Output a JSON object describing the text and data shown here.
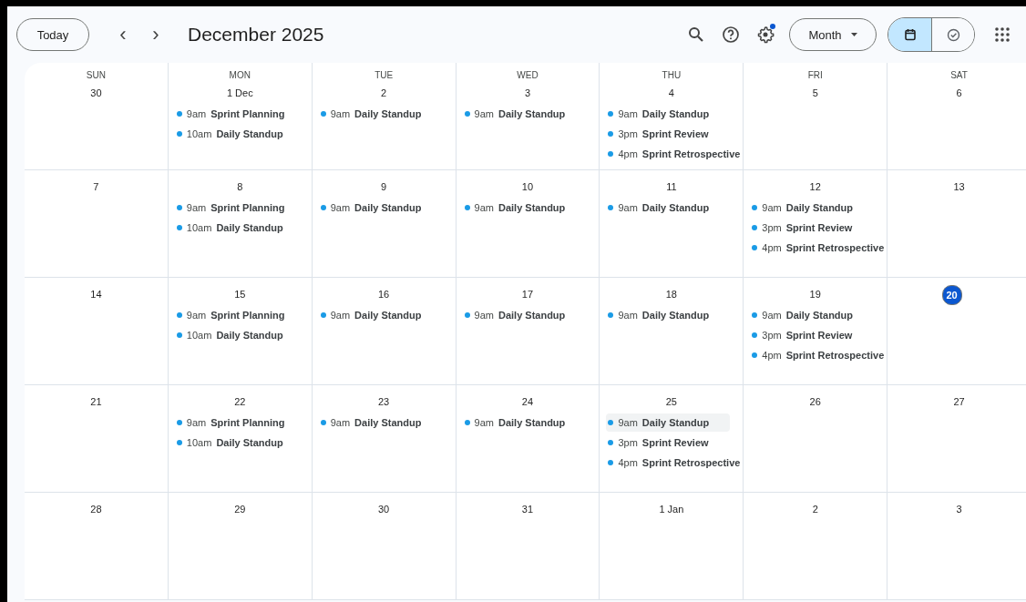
{
  "toolbar": {
    "today_button": "Today",
    "prev": "‹",
    "next": "›",
    "title": "December 2025",
    "view_dropdown": "Month",
    "notification_dot": true,
    "view_toggle": [
      {
        "kind": "calendar",
        "selected": true
      },
      {
        "kind": "tasks",
        "selected": false
      }
    ]
  },
  "weeks": [
    {
      "days": [
        {
          "weekday": "SUN",
          "date": "30",
          "today": false
        },
        {
          "weekday": "MON",
          "date": "1 Dec",
          "today": false,
          "events": [
            {
              "time": "9am",
              "title": "Sprint Planning",
              "color": "#1a9be6",
              "highlighted": false
            },
            {
              "time": "10am",
              "title": "Daily Standup",
              "color": "#1a9be6",
              "highlighted": false
            }
          ]
        },
        {
          "weekday": "TUE",
          "date": "2",
          "today": false,
          "events": [
            {
              "time": "9am",
              "title": "Daily Standup",
              "color": "#1a9be6",
              "highlighted": false
            }
          ]
        },
        {
          "weekday": "WED",
          "date": "3",
          "today": false,
          "events": [
            {
              "time": "9am",
              "title": "Daily Standup",
              "color": "#1a9be6",
              "highlighted": false
            }
          ]
        },
        {
          "weekday": "THU",
          "date": "4",
          "today": false,
          "events": [
            {
              "time": "9am",
              "title": "Daily Standup",
              "color": "#1a9be6",
              "highlighted": false
            },
            {
              "time": "3pm",
              "title": "Sprint Review",
              "color": "#1a9be6",
              "highlighted": false
            },
            {
              "time": "4pm",
              "title": "Sprint Retrospective",
              "color": "#1a9be6",
              "highlighted": false
            }
          ]
        },
        {
          "weekday": "FRI",
          "date": "5",
          "today": false
        },
        {
          "weekday": "SAT",
          "date": "6",
          "today": false
        }
      ]
    },
    {
      "days": [
        {
          "date": "7",
          "today": false
        },
        {
          "date": "8",
          "today": false,
          "events": [
            {
              "time": "9am",
              "title": "Sprint Planning",
              "color": "#1a9be6",
              "highlighted": false
            },
            {
              "time": "10am",
              "title": "Daily Standup",
              "color": "#1a9be6",
              "highlighted": false
            }
          ]
        },
        {
          "date": "9",
          "today": false,
          "events": [
            {
              "time": "9am",
              "title": "Daily Standup",
              "color": "#1a9be6",
              "highlighted": false
            }
          ]
        },
        {
          "date": "10",
          "today": false,
          "events": [
            {
              "time": "9am",
              "title": "Daily Standup",
              "color": "#1a9be6",
              "highlighted": false
            }
          ]
        },
        {
          "date": "11",
          "today": false,
          "events": [
            {
              "time": "9am",
              "title": "Daily Standup",
              "color": "#1a9be6",
              "highlighted": false
            }
          ]
        },
        {
          "date": "12",
          "today": false,
          "events": [
            {
              "time": "9am",
              "title": "Daily Standup",
              "color": "#1a9be6",
              "highlighted": false
            },
            {
              "time": "3pm",
              "title": "Sprint Review",
              "color": "#1a9be6",
              "highlighted": false
            },
            {
              "time": "4pm",
              "title": "Sprint Retrospective",
              "color": "#1a9be6",
              "highlighted": false
            }
          ]
        },
        {
          "date": "13",
          "today": false
        }
      ]
    },
    {
      "days": [
        {
          "date": "14",
          "today": false
        },
        {
          "date": "15",
          "today": false,
          "events": [
            {
              "time": "9am",
              "title": "Sprint Planning",
              "color": "#1a9be6",
              "highlighted": false
            },
            {
              "time": "10am",
              "title": "Daily Standup",
              "color": "#1a9be6",
              "highlighted": false
            }
          ]
        },
        {
          "date": "16",
          "today": false,
          "events": [
            {
              "time": "9am",
              "title": "Daily Standup",
              "color": "#1a9be6",
              "highlighted": false
            }
          ]
        },
        {
          "date": "17",
          "today": false,
          "events": [
            {
              "time": "9am",
              "title": "Daily Standup",
              "color": "#1a9be6",
              "highlighted": false
            }
          ]
        },
        {
          "date": "18",
          "today": false,
          "events": [
            {
              "time": "9am",
              "title": "Daily Standup",
              "color": "#1a9be6",
              "highlighted": false
            }
          ]
        },
        {
          "date": "19",
          "today": false,
          "events": [
            {
              "time": "9am",
              "title": "Daily Standup",
              "color": "#1a9be6",
              "highlighted": false
            },
            {
              "time": "3pm",
              "title": "Sprint Review",
              "color": "#1a9be6",
              "highlighted": false
            },
            {
              "time": "4pm",
              "title": "Sprint Retrospective",
              "color": "#1a9be6",
              "highlighted": false
            }
          ]
        },
        {
          "date": "20",
          "today": true
        }
      ]
    },
    {
      "days": [
        {
          "date": "21",
          "today": false
        },
        {
          "date": "22",
          "today": false,
          "events": [
            {
              "time": "9am",
              "title": "Sprint Planning",
              "color": "#1a9be6",
              "highlighted": false
            },
            {
              "time": "10am",
              "title": "Daily Standup",
              "color": "#1a9be6",
              "highlighted": false
            }
          ]
        },
        {
          "date": "23",
          "today": false,
          "events": [
            {
              "time": "9am",
              "title": "Daily Standup",
              "color": "#1a9be6",
              "highlighted": false
            }
          ]
        },
        {
          "date": "24",
          "today": false,
          "events": [
            {
              "time": "9am",
              "title": "Daily Standup",
              "color": "#1a9be6",
              "highlighted": false
            }
          ]
        },
        {
          "date": "25",
          "today": false,
          "events": [
            {
              "time": "9am",
              "title": "Daily Standup",
              "color": "#1a9be6",
              "highlighted": true
            },
            {
              "time": "3pm",
              "title": "Sprint Review",
              "color": "#1a9be6",
              "highlighted": false
            },
            {
              "time": "4pm",
              "title": "Sprint Retrospective",
              "color": "#1a9be6",
              "highlighted": false
            }
          ]
        },
        {
          "date": "26",
          "today": false
        },
        {
          "date": "27",
          "today": false
        }
      ]
    },
    {
      "days": [
        {
          "date": "28",
          "today": false
        },
        {
          "date": "29",
          "today": false
        },
        {
          "date": "30",
          "today": false
        },
        {
          "date": "31",
          "today": false
        },
        {
          "date": "1 Jan",
          "today": false
        },
        {
          "date": "2",
          "today": false
        },
        {
          "date": "3",
          "today": false
        }
      ]
    }
  ]
}
